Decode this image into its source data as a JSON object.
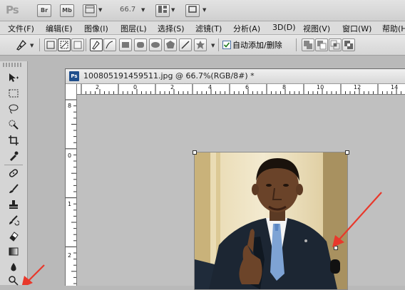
{
  "app": {
    "logo": "Ps",
    "bridge_label": "Br",
    "minibridge_label": "Mb",
    "zoom": "66.7"
  },
  "menu": [
    "文件(F)",
    "编辑(E)",
    "图像(I)",
    "图层(L)",
    "选择(S)",
    "滤镜(T)",
    "分析(A)",
    "3D(D)",
    "视图(V)",
    "窗口(W)",
    "帮助(H)"
  ],
  "options": {
    "auto_add_delete": "自动添加/删除",
    "auto_add_delete_checked": true
  },
  "document": {
    "title": "100805191459511.jpg @ 66.7%(RGB/8#) *",
    "icon_label": "Ps",
    "ruler_h": [
      "2",
      "0",
      "2",
      "4",
      "6",
      "8",
      "10",
      "12",
      "14"
    ],
    "ruler_v": [
      "8",
      "0",
      "1",
      "2"
    ]
  },
  "colors": {
    "accent": "#1f4e8c",
    "annotation_arrow": "#e8382b"
  }
}
